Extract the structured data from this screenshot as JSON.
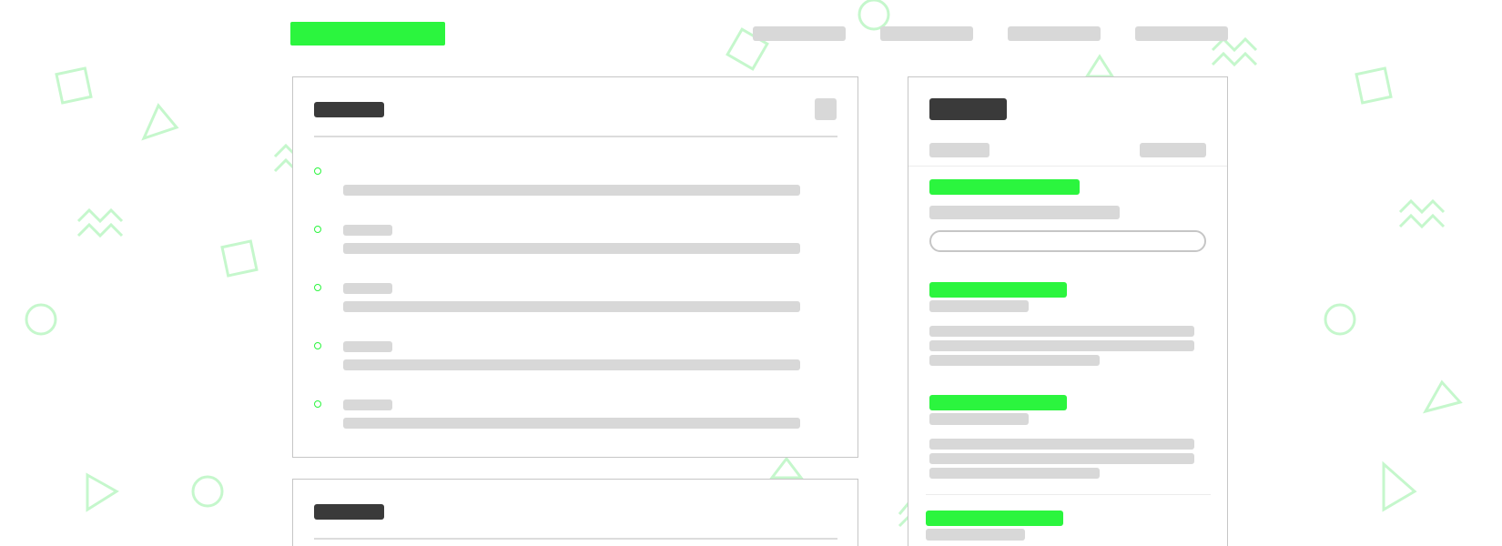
{
  "colors": {
    "accent": "#2bf53e",
    "placeholder": "#d8d8d8",
    "heading": "#3a3a3a",
    "border": "#c6c6c6",
    "decoration": "#c5f7cc"
  },
  "header": {
    "logo_label": "",
    "nav": [
      {
        "label": ""
      },
      {
        "label": ""
      },
      {
        "label": ""
      },
      {
        "label": ""
      }
    ]
  },
  "main_card": {
    "title": "",
    "action_label": "",
    "items": [
      {
        "meta": "",
        "text": ""
      },
      {
        "meta": "",
        "text": ""
      },
      {
        "meta": "",
        "text": ""
      },
      {
        "meta": "",
        "text": ""
      },
      {
        "meta": "",
        "text": ""
      }
    ]
  },
  "second_card": {
    "title": ""
  },
  "sidebar": {
    "title": "",
    "tab_left": "",
    "tab_right": "",
    "promo": {
      "heading": "",
      "subtext": "",
      "input_placeholder": ""
    },
    "posts": [
      {
        "title": "",
        "meta": "",
        "lines": [
          "",
          "",
          ""
        ]
      },
      {
        "title": "",
        "meta": "",
        "lines": [
          "",
          "",
          ""
        ]
      },
      {
        "title": "",
        "meta": ""
      }
    ]
  }
}
